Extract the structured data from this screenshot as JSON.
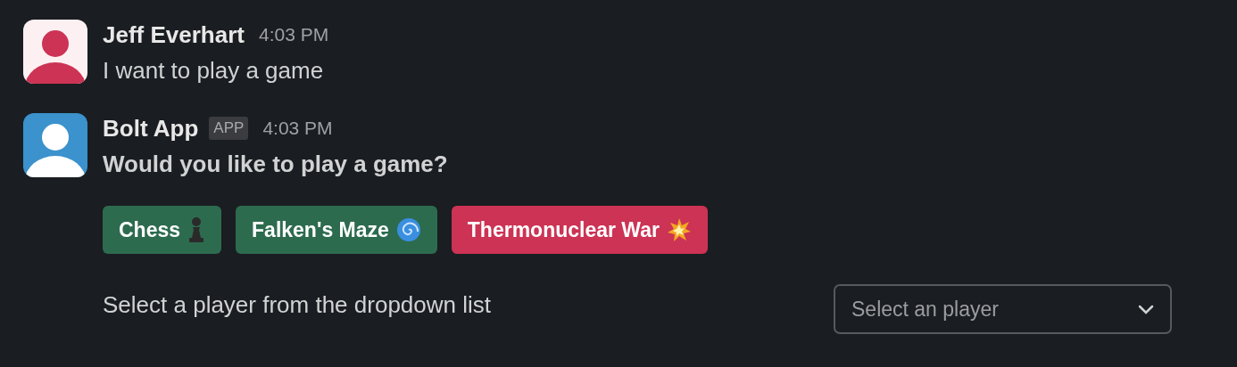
{
  "messages": [
    {
      "kind": "user",
      "author": "Jeff Everhart",
      "time": "4:03 PM",
      "text": "I want to play a game"
    },
    {
      "kind": "app",
      "author": "Bolt App",
      "badge": "APP",
      "time": "4:03 PM",
      "text": "Would you like to play a game?",
      "buttons": [
        {
          "label": "Chess",
          "kind": "primary"
        },
        {
          "label": "Falken's Maze",
          "kind": "primary"
        },
        {
          "label": "Thermonuclear War",
          "kind": "danger"
        }
      ],
      "section": {
        "text": "Select a player from the dropdown list",
        "select": {
          "placeholder": "Select an player"
        }
      }
    }
  ]
}
